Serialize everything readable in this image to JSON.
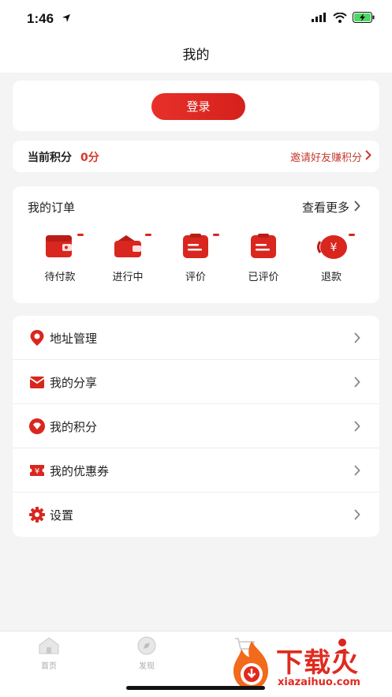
{
  "status_bar": {
    "time": "1:46"
  },
  "header": {
    "title": "我的"
  },
  "login": {
    "button_label": "登录"
  },
  "points": {
    "label": "当前积分",
    "value": "0分",
    "invite_label": "邀请好友赚积分"
  },
  "orders": {
    "title": "我的订单",
    "more_label": "查看更多",
    "items": [
      {
        "label": "待付款",
        "icon": "wallet-icon"
      },
      {
        "label": "进行中",
        "icon": "wallet-open-icon"
      },
      {
        "label": "评价",
        "icon": "clipboard-icon"
      },
      {
        "label": "已评价",
        "icon": "clipboard-done-icon"
      },
      {
        "label": "退款",
        "icon": "refund-yuan-icon",
        "glyph": "¥"
      }
    ]
  },
  "menu": {
    "items": [
      {
        "label": "地址管理",
        "icon": "location-pin-icon"
      },
      {
        "label": "我的分享",
        "icon": "envelope-icon"
      },
      {
        "label": "我的积分",
        "icon": "diamond-icon"
      },
      {
        "label": "我的优惠券",
        "icon": "coupon-icon",
        "glyph": "¥"
      },
      {
        "label": "设置",
        "icon": "gear-icon"
      }
    ]
  },
  "tab_bar": {
    "tabs": [
      {
        "label": "首页",
        "icon": "home-icon"
      },
      {
        "label": "发现",
        "icon": "compass-icon"
      },
      {
        "label": "",
        "icon": "cart-icon"
      },
      {
        "label": "",
        "icon": "profile-icon"
      }
    ]
  },
  "watermark": {
    "text": "下载火",
    "sub": "xiazaihuo.com"
  },
  "colors": {
    "accent": "#d9261e",
    "background": "#f4f4f4",
    "card": "#ffffff"
  }
}
